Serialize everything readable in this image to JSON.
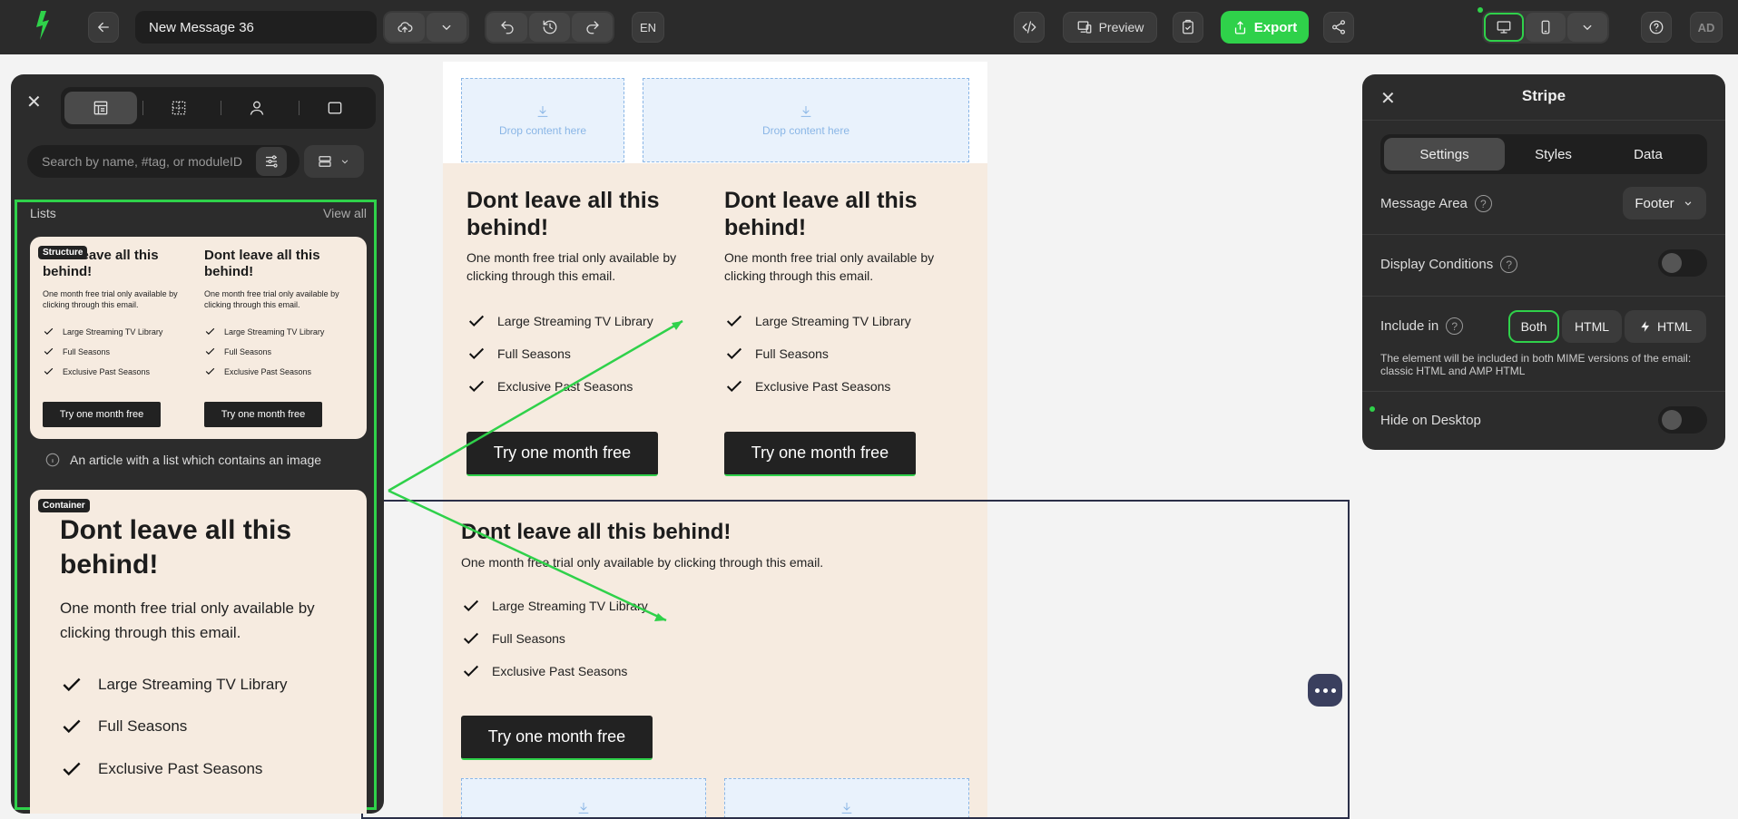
{
  "topbar": {
    "message_title": "New Message 36",
    "language": "EN",
    "preview_label": "Preview",
    "export_label": "Export",
    "avatar_initials": "AD",
    "accent": "#2fd14a"
  },
  "email": {
    "drop_text": "Drop content here",
    "heading": "Dont leave all this behind!",
    "intro": "One month free trial only available by clicking through this email.",
    "features": [
      "Large Streaming TV Library",
      "Full Seasons",
      "Exclusive Past Seasons"
    ],
    "cta": "Try one month free"
  },
  "left_panel": {
    "search_placeholder": "Search by name, #tag, or moduleID",
    "section_title": "Lists",
    "view_all": "View all",
    "card1": {
      "badge": "Structure",
      "heading": "Dont leave all this behind!",
      "intro": "One month free trial only available by clicking through this email.",
      "features": [
        "Large Streaming TV Library",
        "Full Seasons",
        "Exclusive Past Seasons"
      ],
      "cta": "Try one month free"
    },
    "card1_description": "An article with a list which contains an image",
    "card2": {
      "badge": "Container",
      "heading": "Dont leave all this behind!",
      "intro": "One month free trial only available by clicking through this email.",
      "features": [
        "Large Streaming TV Library",
        "Full Seasons",
        "Exclusive Past Seasons"
      ]
    }
  },
  "right_panel": {
    "title": "Stripe",
    "tabs": [
      "Settings",
      "Styles",
      "Data"
    ],
    "active_tab": "Settings",
    "message_area_label": "Message Area",
    "message_area_value": "Footer",
    "display_conditions_label": "Display Conditions",
    "display_conditions_on": false,
    "include_in_label": "Include in",
    "include_options": [
      "Both",
      "HTML",
      "HTML"
    ],
    "include_selected": "Both",
    "include_note": "The element will be included in both MIME versions of the email: classic HTML and AMP HTML",
    "hide_on_desktop_label": "Hide on Desktop",
    "hide_on_desktop_on": false
  }
}
